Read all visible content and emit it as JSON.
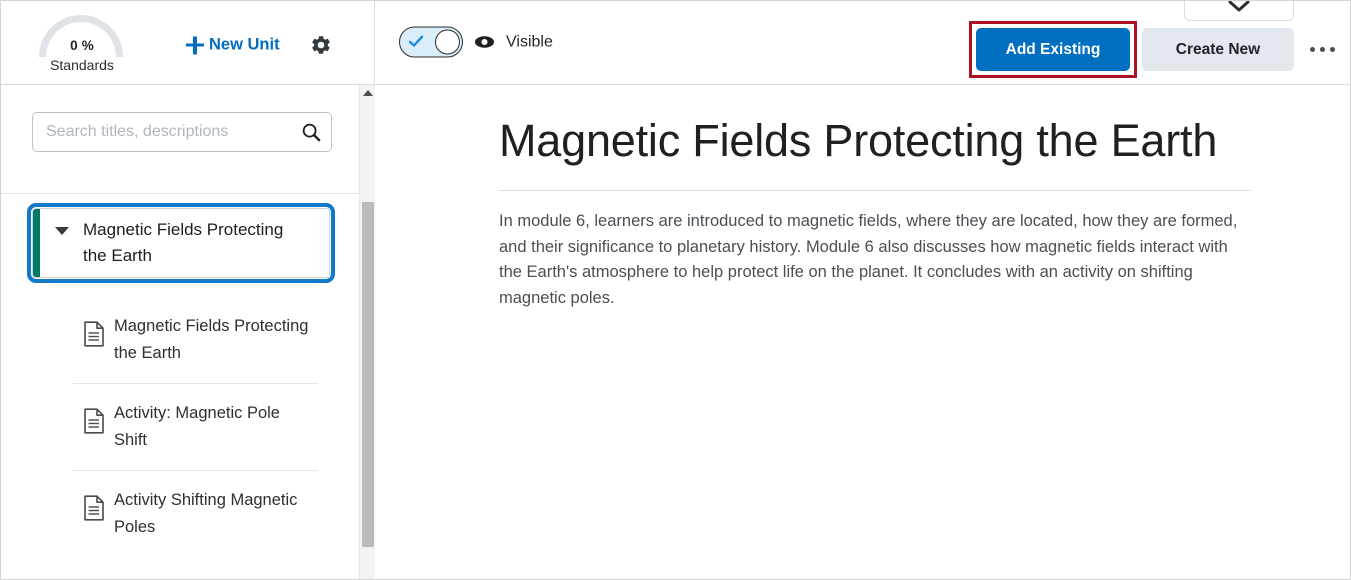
{
  "header": {
    "gauge": {
      "percent": "0 %",
      "label": "Standards",
      "arc_color": "#dfe3e8"
    },
    "new_unit_label": "New Unit",
    "new_unit_icon": "plus-icon",
    "settings_icon": "gear-icon",
    "top_chevron_icon": "chevron-down-icon",
    "visibility": {
      "toggle_state": "on",
      "toggle_check_icon": "check-icon",
      "eye_icon": "eye-icon",
      "label": "Visible"
    },
    "actions": {
      "primary_label": "Add Existing",
      "primary_color": "#006fbf",
      "secondary_label": "Create New",
      "secondary_color": "#e2e8ee",
      "overflow_icon": "ellipsis-icon",
      "highlight_color": "#aa1122"
    }
  },
  "sidebar": {
    "search": {
      "placeholder": "Search titles, descriptions",
      "value": "",
      "icon": "search-icon"
    },
    "unit": {
      "title": "Magnetic Fields Protecting the Earth",
      "expanded": true,
      "caret_icon": "caret-down-icon",
      "accent_color": "#00796b",
      "focus_color": "#1278c8"
    },
    "children": [
      {
        "label": "Magnetic Fields Protecting the Earth",
        "icon": "document-icon"
      },
      {
        "label": "Activity: Magnetic Pole Shift",
        "icon": "document-icon"
      },
      {
        "label": "Activity Shifting Magnetic Poles",
        "icon": "document-icon"
      }
    ],
    "scrollbar": {
      "up_icon": "caret-up-icon"
    }
  },
  "main": {
    "title": "Magnetic Fields Protecting the Earth",
    "body": "In module 6, learners are introduced to magnetic fields, where they are located, how they are formed, and their significance to planetary history. Module 6 also discusses how magnetic fields interact with the Earth's atmosphere to help protect life on the planet. It concludes with an activity on shifting magnetic poles."
  }
}
